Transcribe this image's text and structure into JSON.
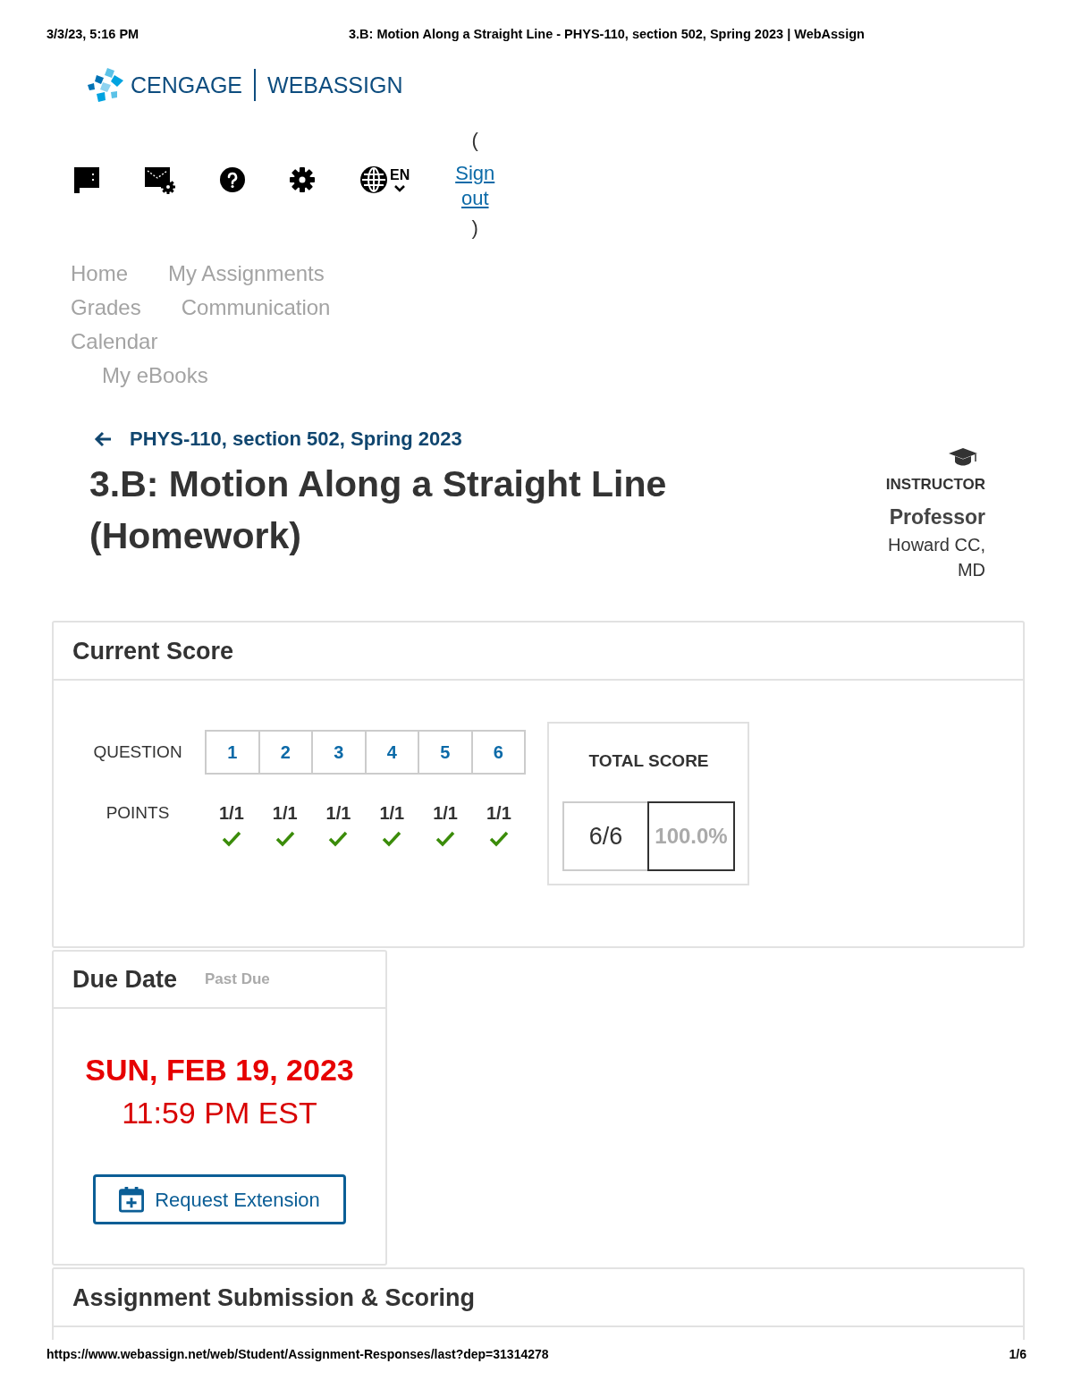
{
  "print_header": {
    "date": "3/3/23, 5:16 PM",
    "title": "3.B: Motion Along a Straight Line - PHYS-110, section 502, Spring 2023 | WebAssign"
  },
  "brand": {
    "name": "CENGAGE",
    "product": "WEBASSIGN"
  },
  "toolbar": {
    "language": "EN",
    "sign_out": {
      "open": "(",
      "link": "Sign out",
      "close": ")"
    }
  },
  "nav": [
    "Home",
    "My Assignments",
    "Grades",
    "Communication",
    "Calendar",
    "My eBooks"
  ],
  "course_link": "PHYS-110, section 502, Spring 2023",
  "title": "3.B: Motion Along a Straight Line (Homework)",
  "instructor": {
    "label": "INSTRUCTOR",
    "title": "Professor",
    "name": "Howard CC, MD"
  },
  "current_score": {
    "heading": "Current Score",
    "question_label": "QUESTION",
    "points_label": "POINTS",
    "questions": [
      {
        "number": "1",
        "points": "1/1",
        "correct": true
      },
      {
        "number": "2",
        "points": "1/1",
        "correct": true
      },
      {
        "number": "3",
        "points": "1/1",
        "correct": true
      },
      {
        "number": "4",
        "points": "1/1",
        "correct": true
      },
      {
        "number": "5",
        "points": "1/1",
        "correct": true
      },
      {
        "number": "6",
        "points": "1/1",
        "correct": true
      }
    ],
    "total": {
      "heading": "TOTAL SCORE",
      "points": "6/6",
      "percent": "100.0%"
    }
  },
  "due_date": {
    "heading": "Due Date",
    "status": "Past Due",
    "date": "SUN, FEB 19, 2023",
    "time": "11:59 PM EST",
    "button": "Request Extension"
  },
  "submission": {
    "heading": "Assignment Submission & Scoring"
  },
  "print_footer": {
    "url": "https://www.webassign.net/web/Student/Assignment-Responses/last?dep=31314278",
    "page": "1/6"
  }
}
